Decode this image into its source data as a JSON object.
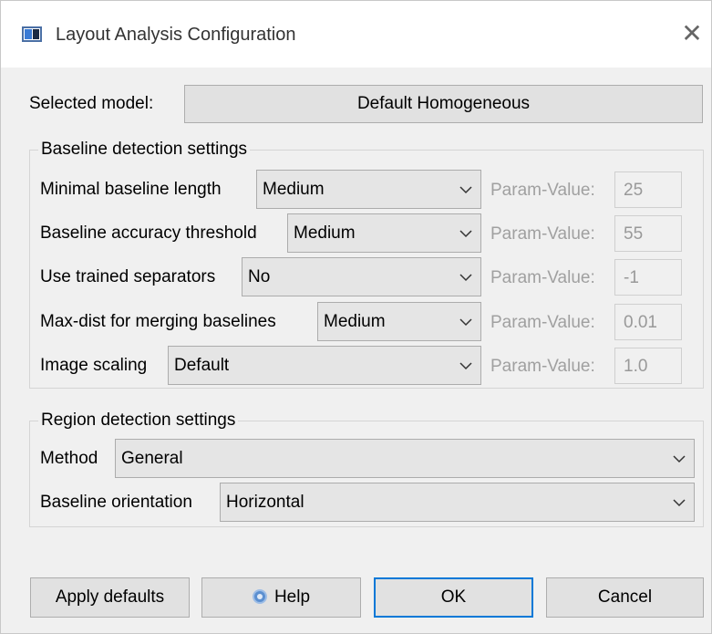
{
  "window": {
    "title": "Layout Analysis Configuration"
  },
  "model": {
    "label": "Selected model:",
    "value": "Default Homogeneous"
  },
  "baseline": {
    "title": "Baseline detection settings",
    "param_label": "Param-Value:",
    "rows": [
      {
        "label": "Minimal baseline length",
        "selected": "Medium",
        "param": "25"
      },
      {
        "label": "Baseline accuracy threshold",
        "selected": "Medium",
        "param": "55"
      },
      {
        "label": "Use trained separators",
        "selected": "No",
        "param": "-1"
      },
      {
        "label": "Max-dist for merging baselines",
        "selected": "Medium",
        "param": "0.01"
      },
      {
        "label": "Image scaling",
        "selected": "Default",
        "param": "1.0"
      }
    ]
  },
  "region": {
    "title": "Region detection settings",
    "rows": [
      {
        "label": "Method",
        "selected": "General"
      },
      {
        "label": "Baseline orientation",
        "selected": "Horizontal"
      }
    ]
  },
  "buttons": {
    "apply_defaults": "Apply defaults",
    "help": "Help",
    "ok": "OK",
    "cancel": "Cancel"
  },
  "icons": {
    "app": "window-app-icon",
    "close": "close-icon",
    "dropdown": "chevron-down-icon",
    "help": "help-icon"
  },
  "colors": {
    "accent": "#0078d7",
    "background": "#f0f0f0",
    "disabled_text": "#a0a0a0"
  }
}
